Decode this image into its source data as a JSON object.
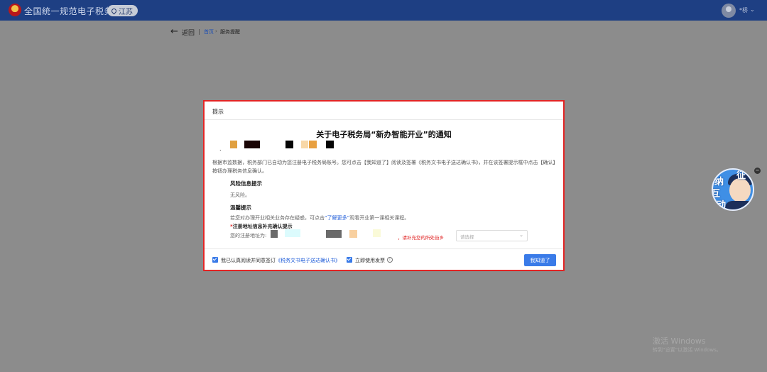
{
  "header": {
    "site_title": "全国统一规范电子税务局",
    "region": "江苏",
    "user_name": "*桥",
    "user_caret": "⌄"
  },
  "nav": {
    "back_arrow": "←",
    "back_label": "返回",
    "breadcrumb_home": "首页",
    "breadcrumb_sep": "›",
    "breadcrumb_current": "服务提醒"
  },
  "dialog": {
    "header_title": "提示",
    "notice_title": "关于电子税务局“新办智能开业”的通知",
    "dot": ".",
    "body_text": "根据市监数据，税务部门已自动为您注册电子税务局账号。您可点击【我知道了】阅读及签署《税务文书电子送达确认书》，并在该签署提示框中点击【确认】按钮办理税务信息确认。",
    "risk_title": "风险信息提示",
    "risk_text": "无风险。",
    "tip_title": "温馨提示",
    "tip_text_before": "若您对办理开业相关业务存在疑惑，可点击",
    "tip_link": "“了解更多”",
    "tip_text_after": "观看开业第一课相关课程。",
    "addr_star": "*",
    "addr_title": "注册地址信息补充确认提示",
    "addr_label": "您的注册地址为:",
    "addr_hint": "，请补充您的所处街乡",
    "select_placeholder": "请选择",
    "select_caret": "⌄",
    "agree_label_before": "我已认真阅读并同意签订",
    "agree_link": "《税务文书电子送达确认书》",
    "invoice_label": "立即使用发票",
    "info_icon": "i",
    "ok_button": "我知道了"
  },
  "mascot": {
    "chars": [
      "征",
      "纳",
      "互",
      "动"
    ],
    "close": "−"
  },
  "watermark": {
    "line1": "激活 Windows",
    "line2": "转到“设置”以激活 Windows。"
  },
  "colors": {
    "header_bg": "#1e3f83",
    "overlay_bg": "#8c8c8c",
    "highlight_border": "#e32424",
    "primary": "#3a7be8",
    "link": "#1d5bd8",
    "warning": "#e02020"
  }
}
